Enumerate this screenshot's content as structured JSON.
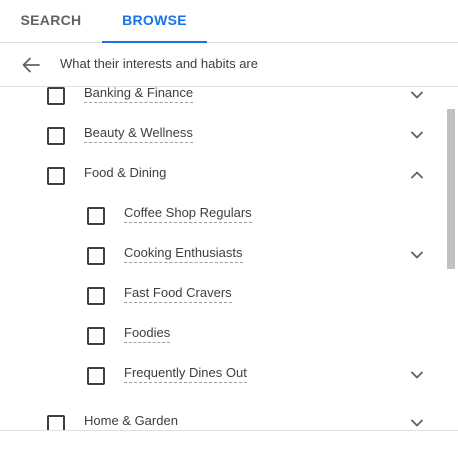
{
  "tabs": [
    {
      "label": "SEARCH",
      "active": false
    },
    {
      "label": "BROWSE",
      "active": true
    }
  ],
  "header": {
    "title": "What their interests and habits are",
    "back_icon": "arrow-left-icon"
  },
  "items": [
    {
      "label": "Banking & Finance",
      "level": 1,
      "chevron": "down",
      "checked": false
    },
    {
      "label": "Beauty & Wellness",
      "level": 1,
      "chevron": "down",
      "checked": false
    },
    {
      "label": "Food & Dining",
      "level": 1,
      "chevron": "up",
      "checked": false
    },
    {
      "label": "Coffee Shop Regulars",
      "level": 2,
      "chevron": "none",
      "checked": false
    },
    {
      "label": "Cooking Enthusiasts",
      "level": 2,
      "chevron": "down",
      "checked": false
    },
    {
      "label": "Fast Food Cravers",
      "level": 2,
      "chevron": "none",
      "checked": false
    },
    {
      "label": "Foodies",
      "level": 2,
      "chevron": "none",
      "checked": false
    },
    {
      "label": "Frequently Dines Out",
      "level": 2,
      "chevron": "down",
      "checked": false
    },
    {
      "label": "Home & Garden",
      "level": 1,
      "chevron": "down",
      "checked": false
    }
  ],
  "colors": {
    "accent": "#1a73e8",
    "text": "#3c4043",
    "inactive_tab": "#5f6368",
    "divider": "#e0e0e0"
  }
}
